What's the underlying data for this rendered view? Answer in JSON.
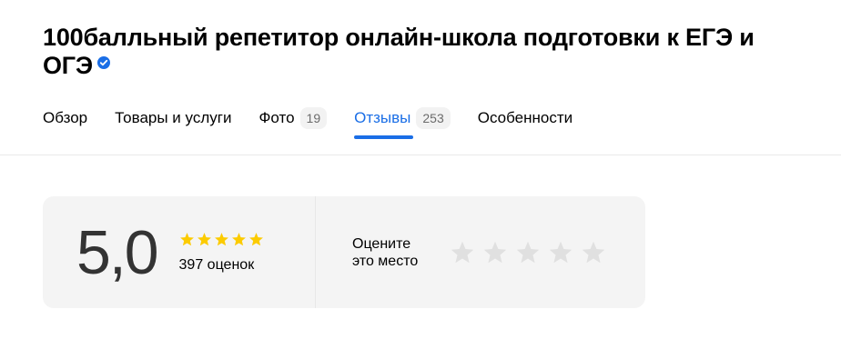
{
  "header": {
    "title": "100балльный репетитор онлайн-школа подготовки к ЕГЭ и ОГЭ",
    "verified_icon": "verified-badge-icon"
  },
  "tabs": [
    {
      "label": "Обзор",
      "count": null,
      "active": false
    },
    {
      "label": "Товары и услуги",
      "count": null,
      "active": false
    },
    {
      "label": "Фото",
      "count": "19",
      "active": false
    },
    {
      "label": "Отзывы",
      "count": "253",
      "active": true
    },
    {
      "label": "Особенности",
      "count": null,
      "active": false
    }
  ],
  "rating": {
    "value": "5,0",
    "stars": 5,
    "count_label": "397 оценок",
    "rate_prompt_line1": "Оцените",
    "rate_prompt_line2": "это место",
    "rate_stars": 5
  },
  "colors": {
    "accent": "#1a6ee6",
    "star_filled": "#fccb00",
    "star_empty": "#e0e0e0"
  }
}
